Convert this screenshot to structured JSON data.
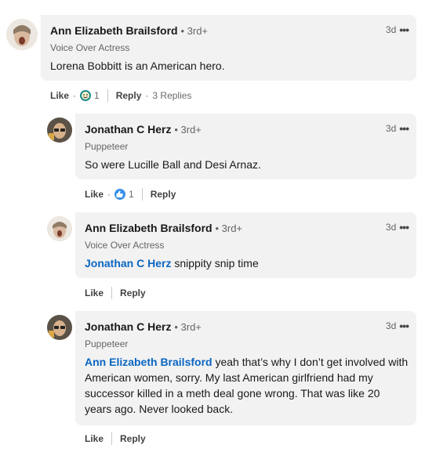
{
  "colors": {
    "link": "#0a66c2",
    "bubble_bg": "#f2f2f2",
    "funny_reaction": "#1a8c8c",
    "like_reaction": "#378fe9"
  },
  "comments": [
    {
      "author": "Ann Elizabeth Brailsford",
      "degree": "• 3rd+",
      "headline": "Voice Over Actress",
      "time": "3d",
      "mention": "",
      "text": "Lorena Bobbitt is an American hero.",
      "like_label": "Like",
      "reaction_icon": "funny-face-icon",
      "reaction_count": "1",
      "reply_label": "Reply",
      "replies_label": "3 Replies"
    },
    {
      "author": "Jonathan C Herz",
      "degree": "• 3rd+",
      "headline": "Puppeteer",
      "time": "3d",
      "mention": "",
      "text": "So were Lucille Ball and Desi Arnaz.",
      "like_label": "Like",
      "reaction_icon": "thumbs-up-icon",
      "reaction_count": "1",
      "reply_label": "Reply"
    },
    {
      "author": "Ann Elizabeth Brailsford",
      "degree": "• 3rd+",
      "headline": "Voice Over Actress",
      "time": "3d",
      "mention": "Jonathan C Herz",
      "text": " snippity snip time",
      "like_label": "Like",
      "reply_label": "Reply"
    },
    {
      "author": "Jonathan C Herz",
      "degree": "• 3rd+",
      "headline": "Puppeteer",
      "time": "3d",
      "mention": "Ann Elizabeth Brailsford",
      "text": " yeah that’s why I don’t get involved with American women, sorry. My last American girlfriend had my successor killed in a meth deal gone wrong. That was like 20 years ago. Never looked back.",
      "like_label": "Like",
      "reply_label": "Reply"
    }
  ]
}
